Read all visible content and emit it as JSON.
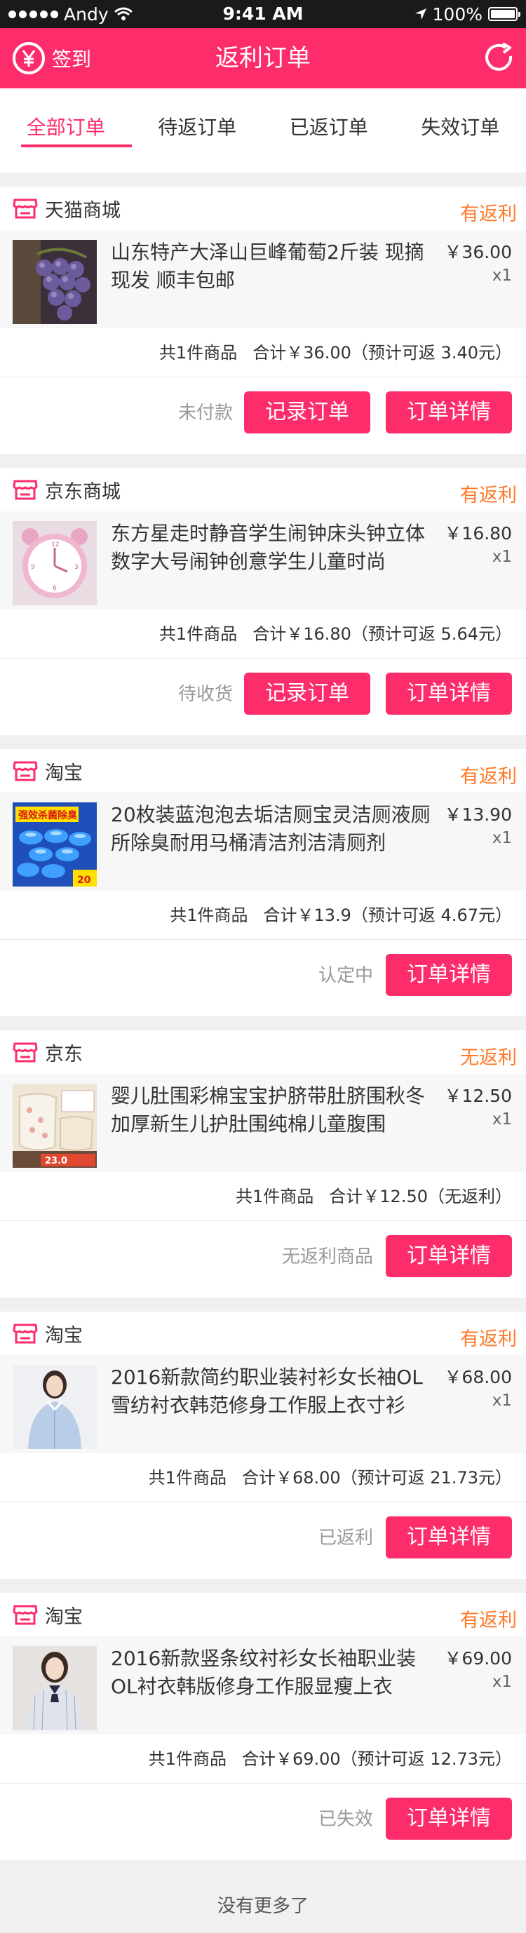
{
  "status_bar": {
    "carrier": "Andy",
    "time": "9:41 AM",
    "battery": "100%"
  },
  "nav": {
    "checkin_label": "签到",
    "title": "返利订单"
  },
  "tabs": [
    {
      "label": "全部订单",
      "active": true
    },
    {
      "label": "待返订单",
      "active": false
    },
    {
      "label": "已返订单",
      "active": false
    },
    {
      "label": "失效订单",
      "active": false
    }
  ],
  "orders": [
    {
      "shop": "天猫商城",
      "rebate": "有返利",
      "title": "山东特产大泽山巨峰葡萄2斤装 现摘现发 顺丰包邮",
      "price": "￥36.00",
      "qty": "x1",
      "count": "共1件商品",
      "total": "合计￥36.00（预计可返 3.40元）",
      "state": "未付款",
      "record_btn": "记录订单",
      "detail_btn": "订单详情"
    },
    {
      "shop": "京东商城",
      "rebate": "有返利",
      "title": "东方星走时静音学生闹钟床头钟立体数字大号闹钟创意学生儿童时尚",
      "price": "￥16.80",
      "qty": "x1",
      "count": "共1件商品",
      "total": "合计￥16.80（预计可返 5.64元）",
      "state": "待收货",
      "record_btn": "记录订单",
      "detail_btn": "订单详情"
    },
    {
      "shop": "淘宝",
      "rebate": "有返利",
      "title": "20枚装蓝泡泡去垢洁厕宝灵洁厕液厕所除臭耐用马桶清洁剂洁清厕剂",
      "price": "￥13.90",
      "qty": "x1",
      "count": "共1件商品",
      "total": "合计￥13.9（预计可返 4.67元）",
      "state": "认定中",
      "detail_btn": "订单详情",
      "thumb_text": "强效杀菌除臭",
      "thumb_text2": "20"
    },
    {
      "shop": "京东",
      "rebate": "无返利",
      "title": "婴儿肚围彩棉宝宝护脐带肚脐围秋冬加厚新生儿护肚围纯棉儿童腹围",
      "price": "￥12.50",
      "qty": "x1",
      "count": "共1件商品",
      "total": "合计￥12.50（无返利）",
      "state": "无返利商品",
      "detail_btn": "订单详情",
      "thumb_text": "23.0"
    },
    {
      "shop": "淘宝",
      "rebate": "有返利",
      "title": "2016新款简约职业装衬衫女长袖OL雪纺衬衣韩范修身工作服上衣寸衫",
      "price": "￥68.00",
      "qty": "x1",
      "count": "共1件商品",
      "total": "合计￥68.00（预计可返 21.73元）",
      "state": "已返利",
      "detail_btn": "订单详情"
    },
    {
      "shop": "淘宝",
      "rebate": "有返利",
      "title": "2016新款竖条纹衬衫女长袖职业装OL衬衣韩版修身工作服显瘦上衣",
      "price": "￥69.00",
      "qty": "x1",
      "count": "共1件商品",
      "total": "合计￥69.00（预计可返 12.73元）",
      "state": "已失效",
      "detail_btn": "订单详情"
    }
  ],
  "footer": "没有更多了",
  "colors": {
    "brand": "#fd2d6b",
    "rebate": "#ff7a2a"
  }
}
